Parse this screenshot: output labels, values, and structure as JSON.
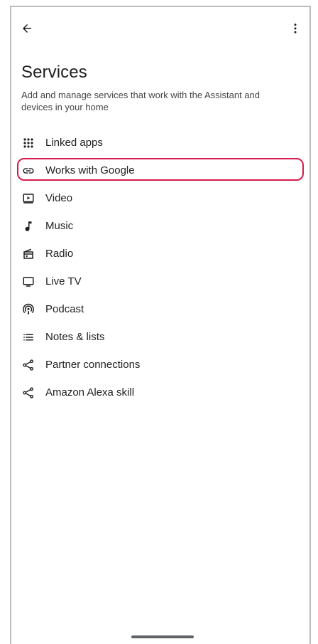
{
  "header": {
    "back_icon": "arrow-back-icon",
    "more_icon": "more-vert-icon"
  },
  "page": {
    "title": "Services",
    "subtitle": "Add and manage services that work with the Assistant and devices in your home"
  },
  "items": [
    {
      "label": "Linked apps",
      "icon": "apps-grid-icon"
    },
    {
      "label": "Works with Google",
      "icon": "link-icon",
      "highlighted": true
    },
    {
      "label": "Video",
      "icon": "video-icon"
    },
    {
      "label": "Music",
      "icon": "music-note-icon"
    },
    {
      "label": "Radio",
      "icon": "radio-icon"
    },
    {
      "label": "Live TV",
      "icon": "tv-icon"
    },
    {
      "label": "Podcast",
      "icon": "podcast-icon"
    },
    {
      "label": "Notes & lists",
      "icon": "list-icon"
    },
    {
      "label": "Partner connections",
      "icon": "share-icon"
    },
    {
      "label": "Amazon Alexa skill",
      "icon": "share-icon"
    }
  ],
  "colors": {
    "highlight_border": "#d81b4c",
    "text_primary": "#1f1f1f",
    "text_secondary": "#444746"
  }
}
